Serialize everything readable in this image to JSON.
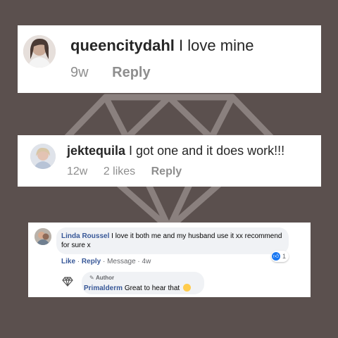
{
  "ig_comment_1": {
    "username": "queencitydahl",
    "text": "I love mine",
    "age": "9w",
    "reply_label": "Reply"
  },
  "ig_comment_2": {
    "username": "jektequila",
    "text": "I got one and it does work!!!",
    "age": "12w",
    "likes": "2 likes",
    "reply_label": "Reply"
  },
  "fb_comment": {
    "name": "Linda Roussel",
    "text": "I love it both me and my husband use it xx recommend for sure x",
    "like_label": "Like",
    "reply_label": "Reply",
    "message_label": "Message",
    "age": "4w",
    "reaction_count": "1",
    "sep": "·",
    "reply": {
      "author_badge": "Author",
      "name": "Primalderm",
      "text": "Great to hear that"
    }
  },
  "colors": {
    "background": "#5b504e",
    "fb_name": "#385898",
    "like_blue": "#1877f2",
    "muted": "#8e8e8e"
  }
}
